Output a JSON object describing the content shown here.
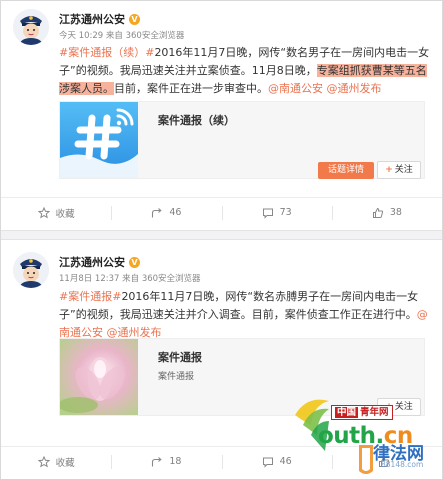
{
  "posts": [
    {
      "username": "江苏通州公安",
      "verified_badge": "V",
      "meta": "今天 10:29 来自 360安全浏览器",
      "text": {
        "hashtag": "#案件通报（续）#",
        "part1": "2016年11月7日晚，网传“数名男子在一房间内电击一女子”的视频。我局迅速关注并立案侦查。11月8日晚，",
        "highlight": "专案组抓获曹某等五名涉案人员。",
        "part2": "目前，案件正在进一步审查中。",
        "mention1": "@南通公安",
        "sep": " ",
        "mention2": "@通州发布"
      },
      "card": {
        "title": "案件通报（续）",
        "subtitle": "",
        "topic_button": "话题详情",
        "follow_button": "关注",
        "thumb_icon": "hashtag-icon"
      },
      "actions": [
        {
          "icon": "collect-icon",
          "label": "收藏"
        },
        {
          "icon": "repost-icon",
          "label": "46"
        },
        {
          "icon": "comment-icon",
          "label": "73"
        },
        {
          "icon": "like-icon",
          "label": "38"
        }
      ]
    },
    {
      "username": "江苏通州公安",
      "verified_badge": "V",
      "meta": "11月8日 12:37 来自 360安全浏览器",
      "text": {
        "hashtag": "#案件通报#",
        "part1": "2016年11月7日晚，网传“数名赤膊男子在一房间内电击一女子”的视频，我局迅速关注并介入调查。目前，案件侦查工作正在进行中。",
        "mention1": "@南通公安",
        "sep": " ",
        "mention2": "@通州发布"
      },
      "card": {
        "title": "案件通报",
        "subtitle": "案件通报",
        "follow_button": "关注",
        "thumb_icon": "lotus-flower-image"
      },
      "actions": [
        {
          "icon": "collect-icon",
          "label": "收藏"
        },
        {
          "icon": "repost-icon",
          "label": "18"
        },
        {
          "icon": "comment-icon",
          "label": "46"
        },
        {
          "icon": "like-icon",
          "label": ""
        }
      ]
    }
  ],
  "watermark": {
    "cn_prefix": "中国",
    "cn_name": "青年网",
    "youth": "outh.",
    "youth_cn": "cn",
    "lfw": "律法网",
    "domain": "88148.com"
  },
  "colors": {
    "link": "#eb7350",
    "highlight": "#f7b29c",
    "topic_button": "#f2794a",
    "badge": "#f5a623",
    "hashtag_tile": "#3aa5f0"
  }
}
